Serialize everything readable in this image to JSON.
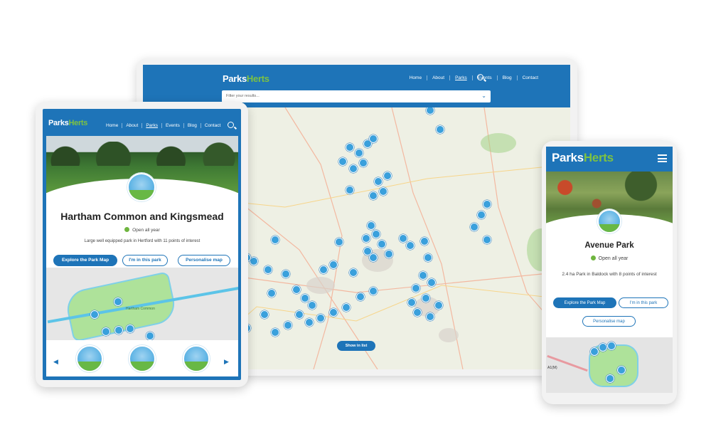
{
  "brand": {
    "name_main": "Parks",
    "name_accent": "Herts",
    "primary_color": "#1e74b8",
    "accent_color": "#7dc242"
  },
  "nav": {
    "items": [
      "Home",
      "About",
      "Parks",
      "Events",
      "Blog",
      "Contact"
    ],
    "active": "Parks"
  },
  "desktop": {
    "filter_placeholder": "Filter your results...",
    "show_in_list_label": "Show in list"
  },
  "tablet": {
    "park_title": "Hartham Common and Kingsmead",
    "open_status": "Open all year",
    "description": "Large well equipped park in Hertford with 11 points of interest",
    "buttons": {
      "explore": "Explore the Park Map",
      "in_park": "I'm in this park",
      "personalise": "Personalise map"
    },
    "map_label": "Hartham Common",
    "nav_prev": "◀",
    "nav_next": "▶"
  },
  "phone": {
    "park_title": "Avenue Park",
    "open_status": "Open all year",
    "description": "2.4 ha Park in Baldock with 8 points of interest",
    "buttons": {
      "explore": "Explore the Park Map",
      "in_park": "I'm in this park",
      "personalise": "Personalise map"
    },
    "map_label": "A1(M)"
  }
}
